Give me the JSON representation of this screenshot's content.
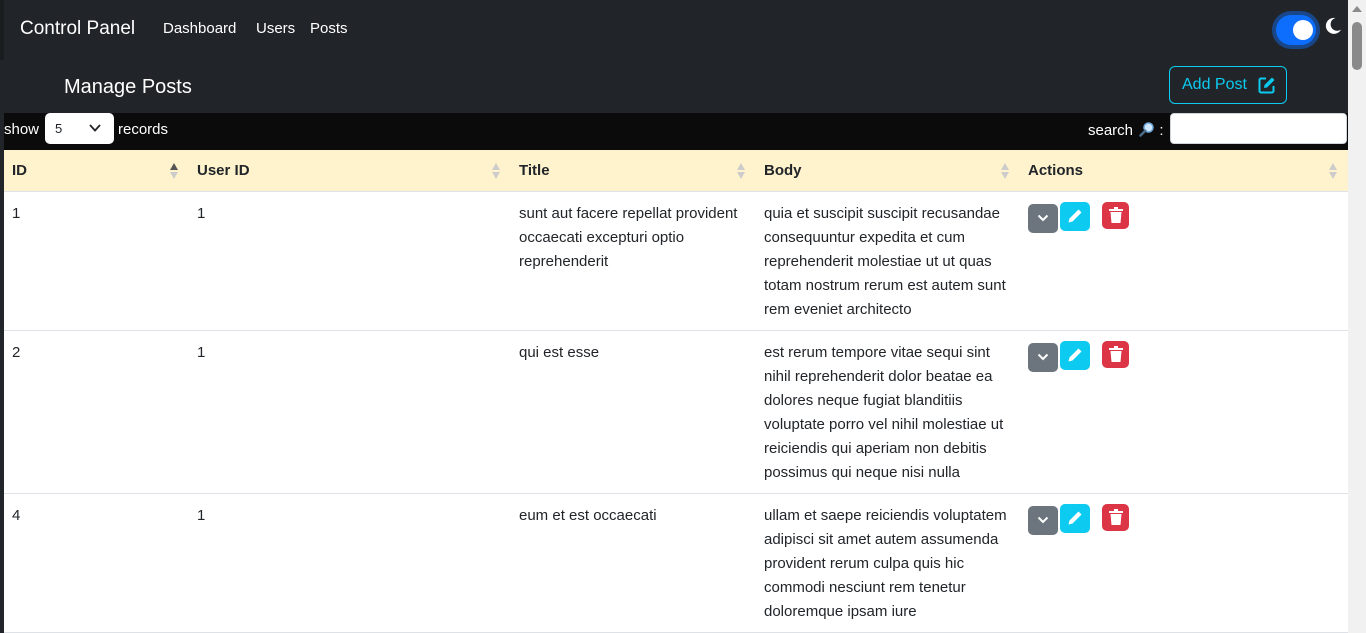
{
  "navbar": {
    "brand": "Control Panel",
    "links": [
      "Dashboard",
      "Users",
      "Posts"
    ],
    "theme_toggle_on": true
  },
  "header": {
    "title": "Manage Posts",
    "add_button": "Add Post"
  },
  "controls": {
    "show_label": "show",
    "records_label": "records",
    "page_size": "5",
    "search_label": "search",
    "search_suffix": ":",
    "search_value": ""
  },
  "table": {
    "columns": [
      "ID",
      "User ID",
      "Title",
      "Body",
      "Actions"
    ],
    "sorted_column": "ID",
    "rows": [
      {
        "id": "1",
        "user_id": "1",
        "title": "sunt aut facere repellat provident occaecati excepturi optio reprehenderit",
        "body": "quia et suscipit suscipit recusandae consequuntur expedita et cum reprehenderit molestiae ut ut quas totam nostrum rerum est autem sunt rem eveniet architecto"
      },
      {
        "id": "2",
        "user_id": "1",
        "title": "qui est esse",
        "body": "est rerum tempore vitae sequi sint nihil reprehenderit dolor beatae ea dolores neque fugiat blanditiis voluptate porro vel nihil molestiae ut reiciendis qui aperiam non debitis possimus qui neque nisi nulla"
      },
      {
        "id": "4",
        "user_id": "1",
        "title": "eum et est occaecati",
        "body": "ullam et saepe reiciendis voluptatem adipisci sit amet autem assumenda provident rerum culpa quis hic commodi nesciunt rem tenetur doloremque ipsam iure"
      }
    ]
  },
  "colors": {
    "navbar_bg": "#212529",
    "header_row_bg": "#fff3cd",
    "accent_info": "#0dcaf0",
    "danger": "#dc3545",
    "secondary": "#6c757d",
    "primary": "#0d6efd"
  }
}
